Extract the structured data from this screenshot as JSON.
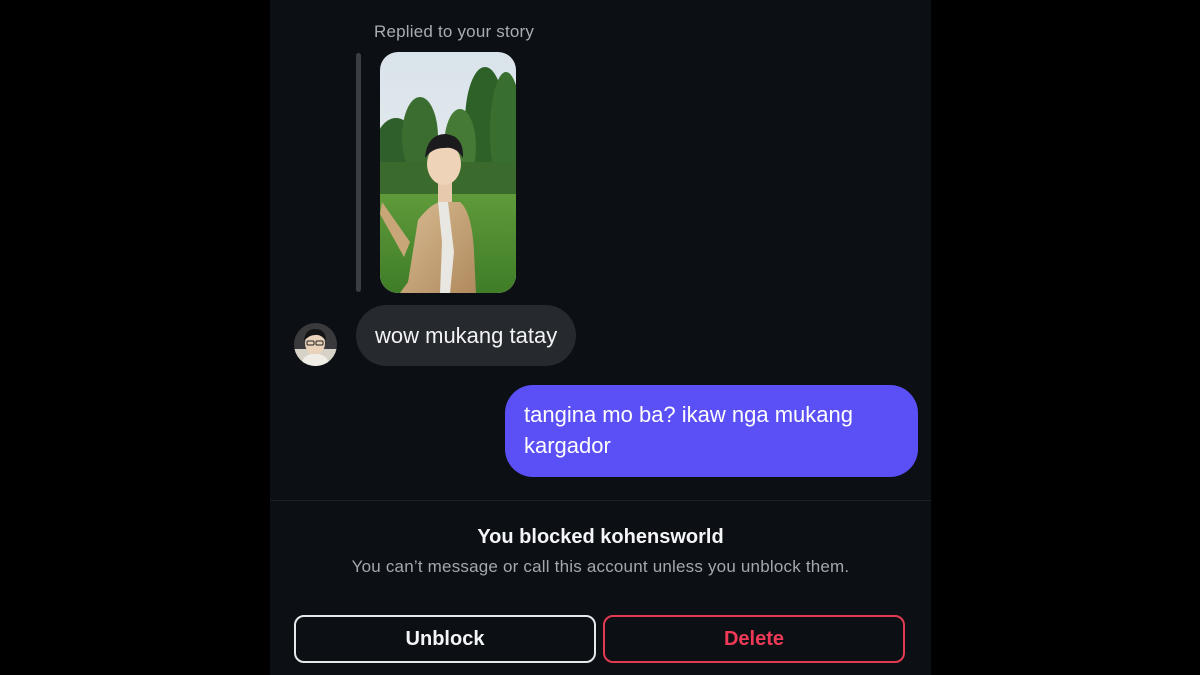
{
  "conversation": {
    "reply_context": "Replied to your story",
    "story_thumbnail": {
      "icon": "story-photo-person-in-park"
    },
    "incoming_message": {
      "text": "wow mukang tatay",
      "avatar": "profile-photo-avatar"
    },
    "outgoing_message": {
      "line1": "tangina mo ba? ikaw nga mukang",
      "line2": "kargador"
    }
  },
  "blocked_notice": {
    "title": "You blocked kohensworld",
    "description": "You can’t message or call this account unless you unblock them."
  },
  "actions": {
    "unblock_label": "Unblock",
    "delete_label": "Delete"
  },
  "colors": {
    "background": "#0c0f14",
    "incoming_bubble": "#262a2f",
    "outgoing_bubble": "#5b4ff6",
    "delete_red": "#ee3a57"
  }
}
